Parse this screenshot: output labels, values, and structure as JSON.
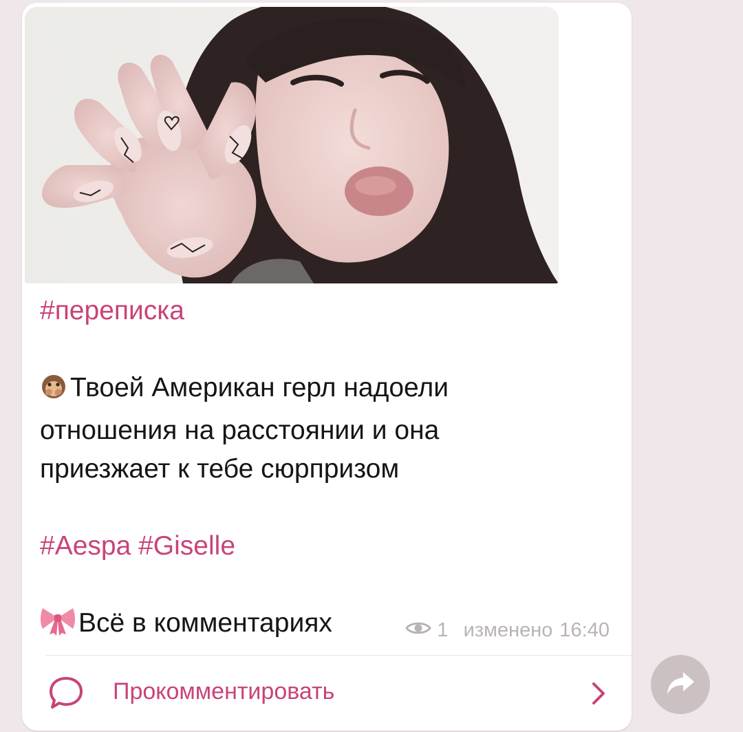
{
  "post": {
    "tag_line": "#переписка",
    "body_emoji": "🙊",
    "body_lines": [
      "Твоей Американ герл надоели",
      "отношения на расстоянии и она",
      "приезжает к тебе сюрпризом"
    ],
    "tags": "#Aespa #Giselle",
    "footer_emoji": "🎀",
    "footer_text": "Всё в комментариях",
    "views": "1",
    "edited_label": "изменено",
    "time": "16:40"
  },
  "comments": {
    "label": "Прокомментировать"
  },
  "icons": {
    "views": "eye-icon",
    "comment": "comment-bubble-icon",
    "chevron": "chevron-right-icon",
    "forward": "forward-arrow-icon"
  },
  "colors": {
    "accent": "#c8437a",
    "background": "#efe7e9",
    "bubble": "#ffffff",
    "meta": "#b9b3b5",
    "forward_button": "#cbc1c3"
  }
}
